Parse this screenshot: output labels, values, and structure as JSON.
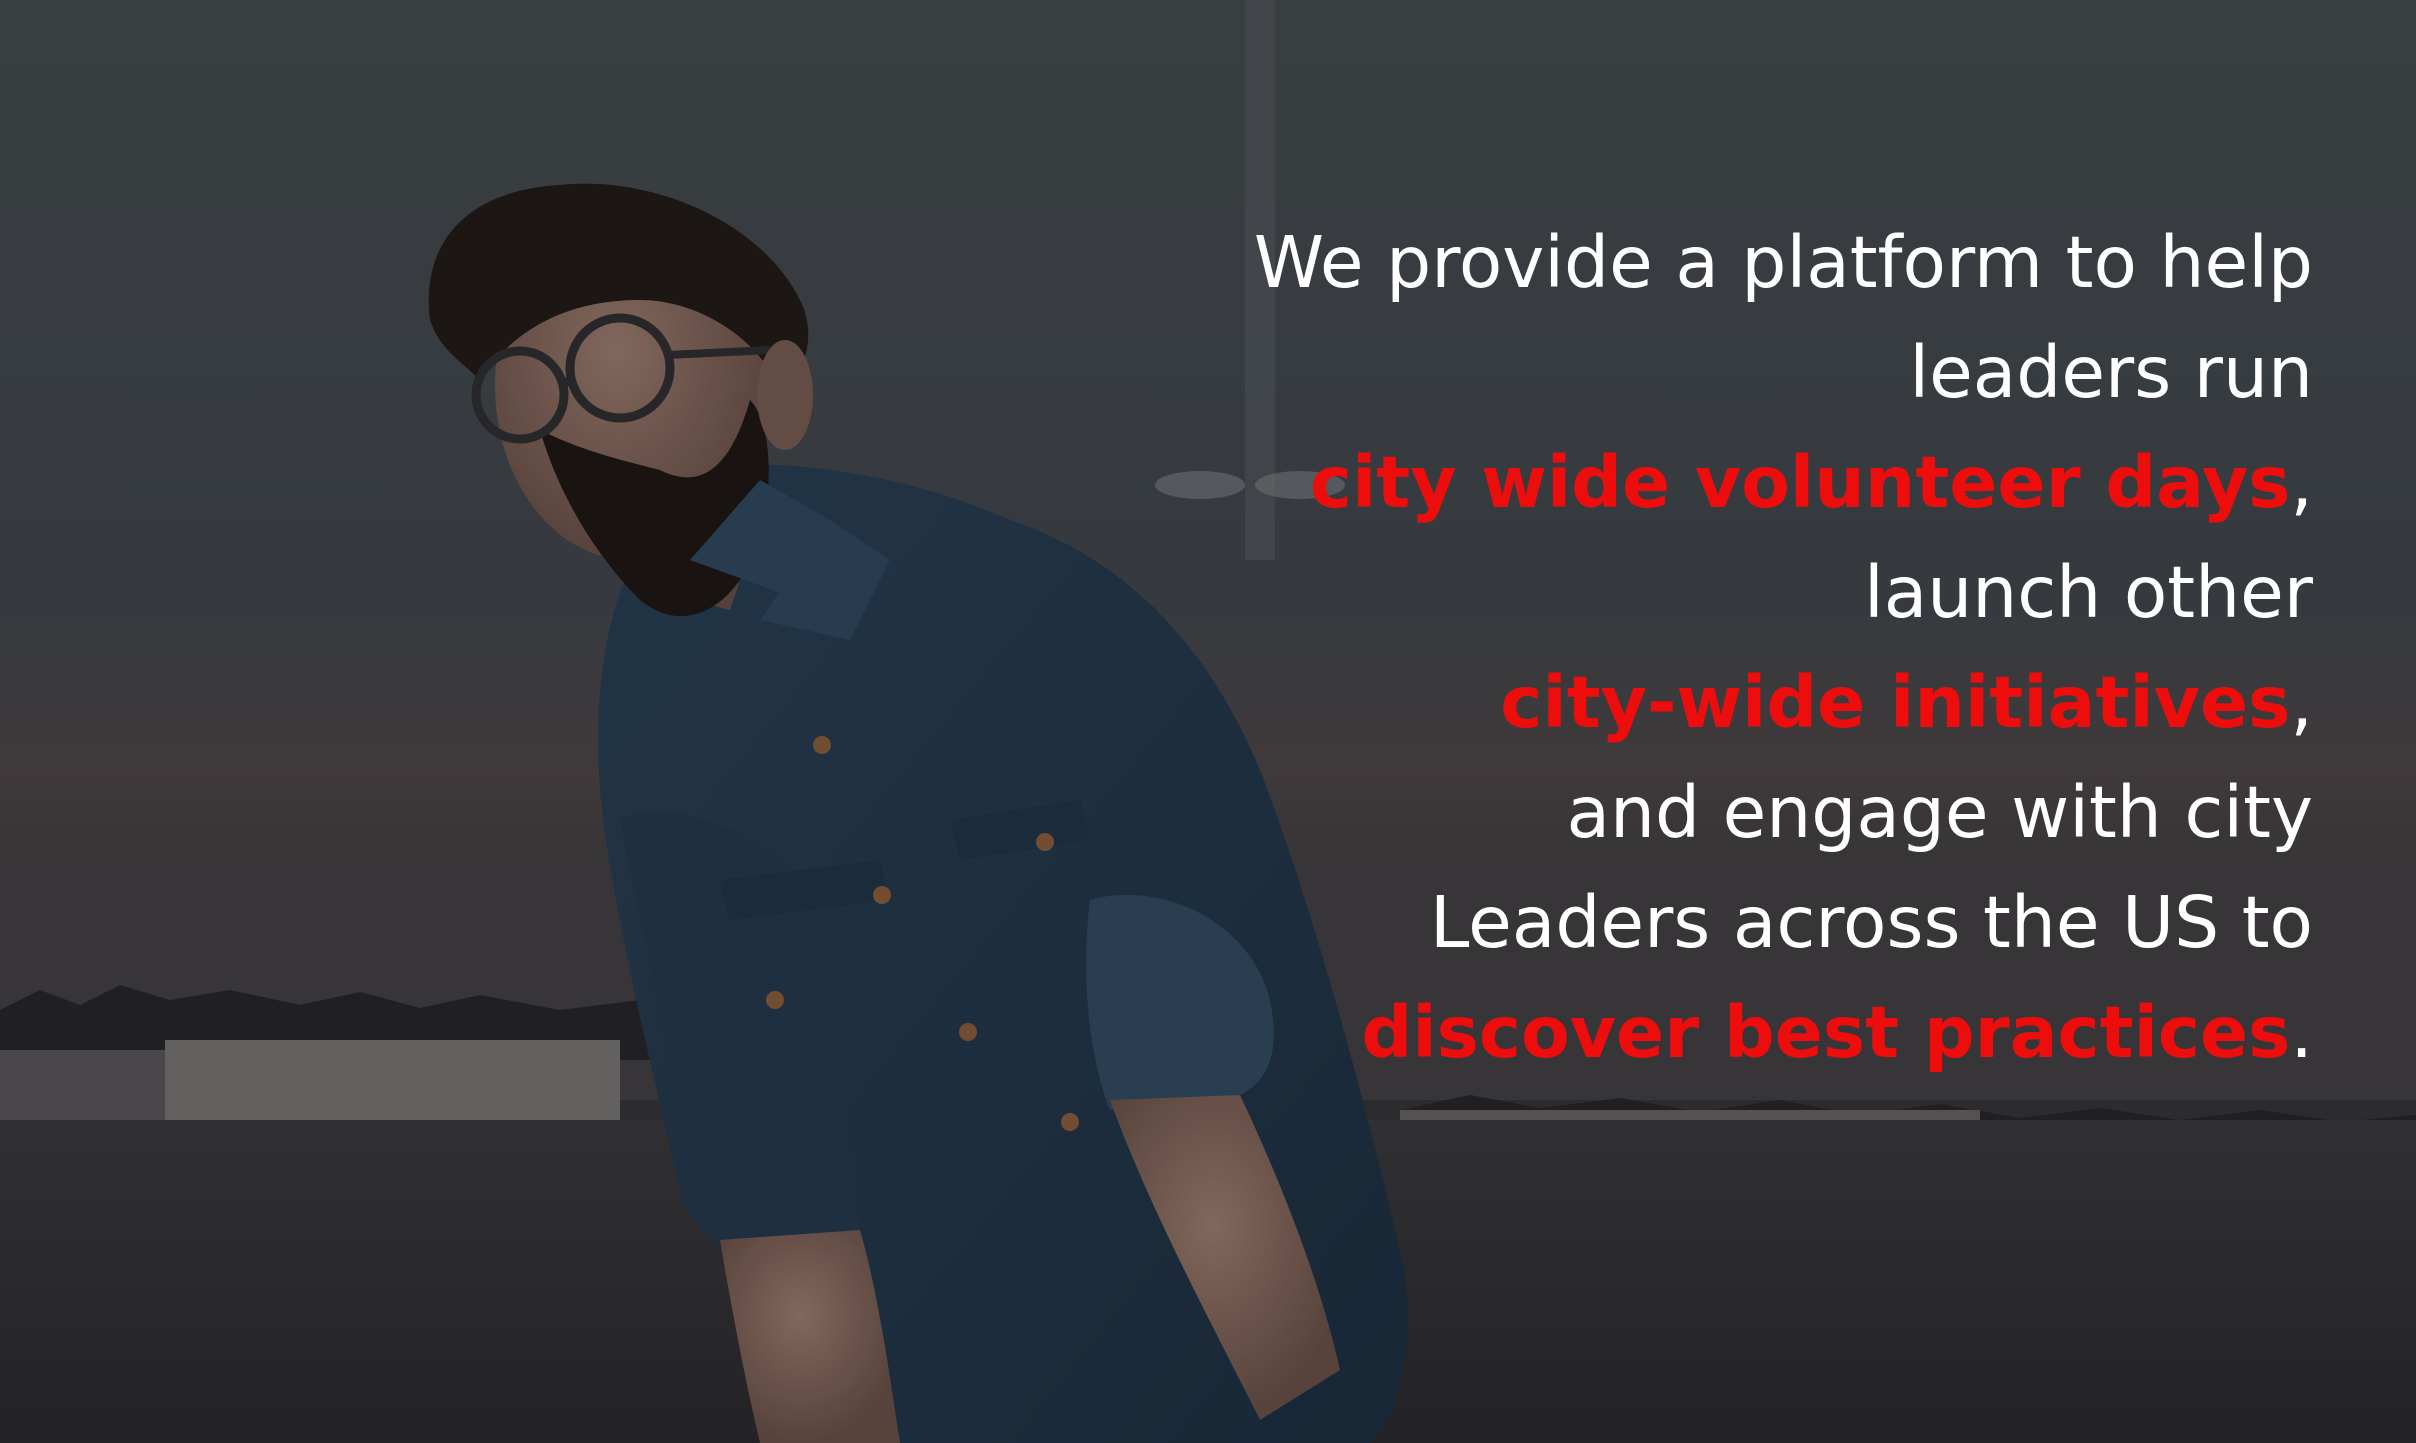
{
  "hero": {
    "colors": {
      "text": "#ffffff",
      "highlight": "#ee0d0d"
    },
    "headline": {
      "line_1": "We provide a platform to help",
      "line_2": "leaders run",
      "highlight_1": "city wide volunteer days",
      "comma_1": ",",
      "line_4": "launch other",
      "highlight_2": "city-wide initiatives",
      "comma_2": ",",
      "line_6": "and engage with city",
      "line_7": "Leaders across the US to",
      "highlight_3": "discover best practices",
      "period": "."
    }
  }
}
